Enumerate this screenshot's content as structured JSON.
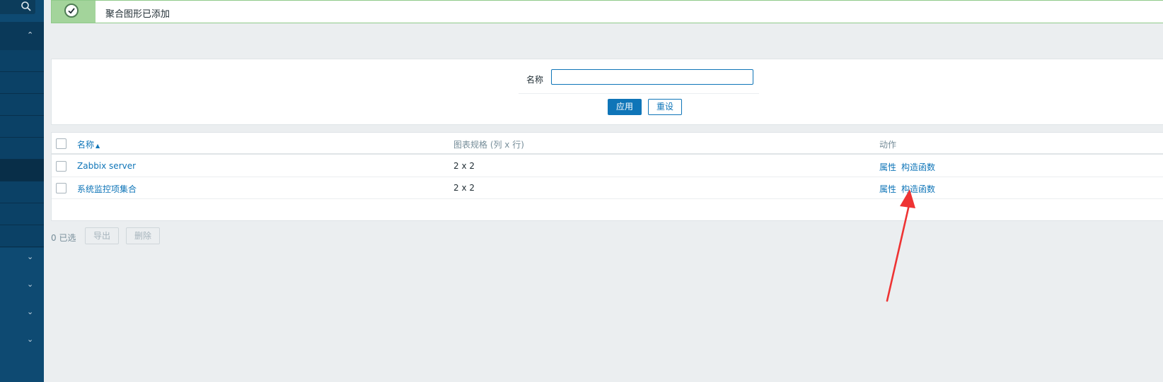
{
  "notification": {
    "text": "聚合图形已添加"
  },
  "filter": {
    "name_label": "名称",
    "name_value": "",
    "apply_label": "应用",
    "reset_label": "重设"
  },
  "table": {
    "columns": {
      "name": "名称",
      "dimensions": "图表规格 (列 x 行)",
      "actions": "动作"
    },
    "rows": [
      {
        "name": "Zabbix server",
        "dimensions": "2 x 2",
        "properties": "属性",
        "constructor": "构造函数"
      },
      {
        "name": "系统监控项集合",
        "dimensions": "2 x 2",
        "properties": "属性",
        "constructor": "构造函数"
      }
    ]
  },
  "footer": {
    "selected": "0 已选",
    "export_label": "导出",
    "delete_label": "删除"
  },
  "sidebar": {
    "expand_icon": "chevron-up-icon",
    "collapsed_icon": "chevron-down-icon",
    "search_icon": "search-icon"
  },
  "colors": {
    "accent": "#0f75b8",
    "sidebar": "#0e4a72",
    "success": "#a3d49b",
    "annotation": "#ee3333"
  }
}
